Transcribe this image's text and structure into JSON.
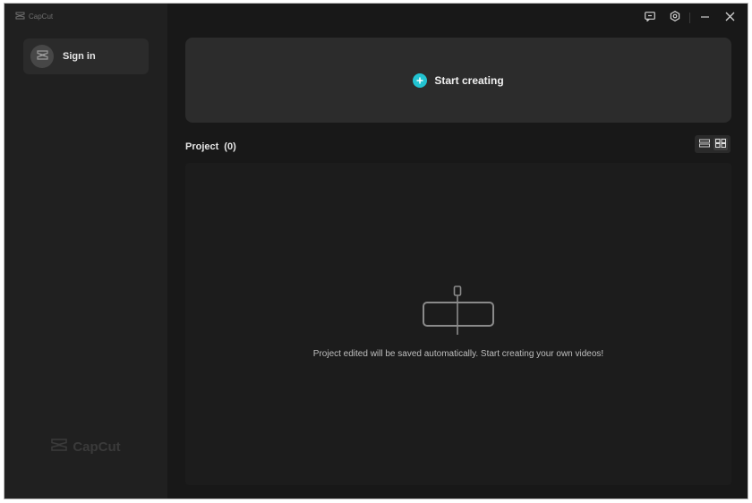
{
  "app": {
    "title": "CapCut"
  },
  "sidebar": {
    "sign_in_label": "Sign in",
    "watermark_text": "CapCut"
  },
  "window_controls": {
    "icons": [
      "feedback-icon",
      "settings-icon",
      "minimize-icon",
      "close-icon"
    ]
  },
  "main": {
    "start_label": "Start creating",
    "project_title": "Project",
    "project_count": "(0)",
    "empty_message": "Project edited will be saved automatically. Start creating your own videos!",
    "view_modes": [
      "list-view-icon",
      "grid-view-icon"
    ],
    "active_view": "grid"
  },
  "colors": {
    "accent": "#22c3d1",
    "background": "#181818",
    "sidebar": "#202020",
    "card": "#2c2c2c"
  }
}
